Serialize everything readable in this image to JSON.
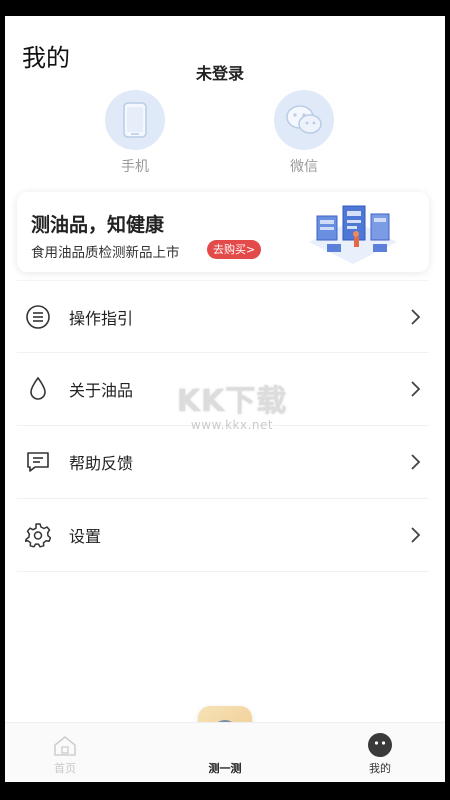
{
  "header": {
    "title": "我的",
    "login_status": "未登录"
  },
  "login_options": [
    {
      "label": "手机",
      "icon": "phone-icon"
    },
    {
      "label": "微信",
      "icon": "wechat-icon"
    }
  ],
  "banner": {
    "title": "测油品，知健康",
    "subtitle": "食用油品质检测新品上市",
    "button": "去购买>",
    "accent": "#e34a4a"
  },
  "menu": [
    {
      "label": "操作指引",
      "icon": "list-icon"
    },
    {
      "label": "关于油品",
      "icon": "oil-drop-icon"
    },
    {
      "label": "帮助反馈",
      "icon": "feedback-icon"
    },
    {
      "label": "设置",
      "icon": "settings-gear-icon"
    }
  ],
  "watermark": {
    "logo": "KK下载",
    "url": "www.kkx.net"
  },
  "tabbar": {
    "items": [
      {
        "label": "首页",
        "icon": "home-icon",
        "active": false
      },
      {
        "label": "测一测",
        "icon": "measure-icon",
        "active": true
      },
      {
        "label": "我的",
        "icon": "profile-face-icon",
        "active": true
      }
    ]
  }
}
